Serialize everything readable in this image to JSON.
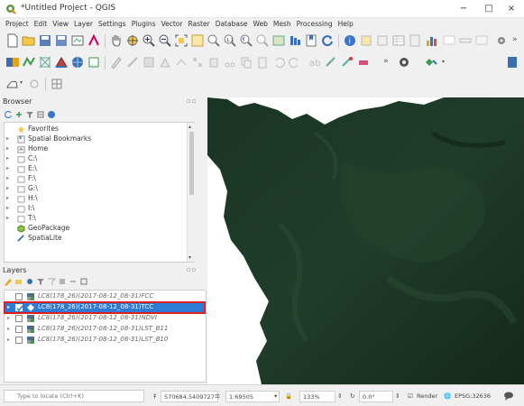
{
  "window": {
    "title": "*Untitled Project - QGIS",
    "minimize": "−",
    "maximize": "□",
    "close": "×"
  },
  "menu": [
    "Project",
    "Edit",
    "View",
    "Layer",
    "Settings",
    "Plugins",
    "Vector",
    "Raster",
    "Database",
    "Web",
    "Mesh",
    "Processing",
    "Help"
  ],
  "toolbar_overflow": "»",
  "browser": {
    "title": "Browser",
    "items": [
      {
        "label": "Favorites",
        "icon": "star-icon"
      },
      {
        "label": "Spatial Bookmarks",
        "icon": "bookmark-icon"
      },
      {
        "label": "Home",
        "icon": "home-folder-icon"
      },
      {
        "label": "C:\\",
        "icon": "drive-icon"
      },
      {
        "label": "E:\\",
        "icon": "drive-icon"
      },
      {
        "label": "F:\\",
        "icon": "drive-icon"
      },
      {
        "label": "G:\\",
        "icon": "drive-icon"
      },
      {
        "label": "H:\\",
        "icon": "drive-icon"
      },
      {
        "label": "I:\\",
        "icon": "drive-icon"
      },
      {
        "label": "T:\\",
        "icon": "drive-icon"
      },
      {
        "label": "GeoPackage",
        "icon": "geopackage-icon"
      },
      {
        "label": "SpatiaLite",
        "icon": "spatialite-icon"
      }
    ]
  },
  "layers": {
    "title": "Layers",
    "items": [
      {
        "label": "LC8(178_26)(2017-08-12_08-31)FCC",
        "checked": false,
        "selected": false
      },
      {
        "label": "LC8(178_26)(2017-08-12_08-31)TCC",
        "checked": true,
        "selected": true
      },
      {
        "label": "LC8(178_26)(2017-08-12_08-31)NDVI",
        "checked": false,
        "selected": false
      },
      {
        "label": "LC8(178_26)(2017-08-12_08-31)LST_B11",
        "checked": false,
        "selected": false
      },
      {
        "label": "LC8(178_26)(2017-08-12_08-31)LST_B10",
        "checked": false,
        "selected": false
      }
    ]
  },
  "status": {
    "search_placeholder": "Type to locate (Ctrl+K)",
    "coordinate": "570684,5409727",
    "scale": "1:69505",
    "magnifier": "133%",
    "rotation": "0.0°",
    "render_label": "Render",
    "crs": "EPSG:32636"
  },
  "colors": {
    "selection": "#2e7bd6",
    "highlight_outline": "#e02020",
    "map_dark": "#10261a",
    "map_mid": "#23402c"
  }
}
